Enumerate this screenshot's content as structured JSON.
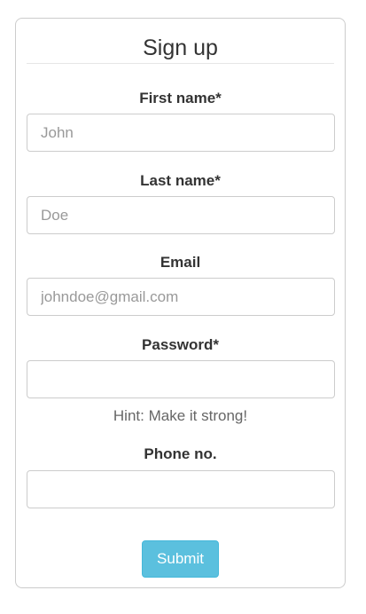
{
  "form": {
    "title": "Sign up",
    "first_name": {
      "label": "First name*",
      "value": "",
      "placeholder": "John"
    },
    "last_name": {
      "label": "Last name*",
      "value": "",
      "placeholder": "Doe"
    },
    "email": {
      "label": "Email",
      "value": "",
      "placeholder": "johndoe@gmail.com"
    },
    "password": {
      "label": "Password*",
      "value": "",
      "placeholder": "",
      "hint": "Hint: Make it strong!"
    },
    "phone": {
      "label": "Phone no.",
      "value": "",
      "placeholder": ""
    },
    "submit_label": "Submit"
  },
  "colors": {
    "accent": "#5bc0de",
    "border": "#cccccc",
    "text": "#333333",
    "placeholder": "#999999",
    "hint": "#666666"
  }
}
